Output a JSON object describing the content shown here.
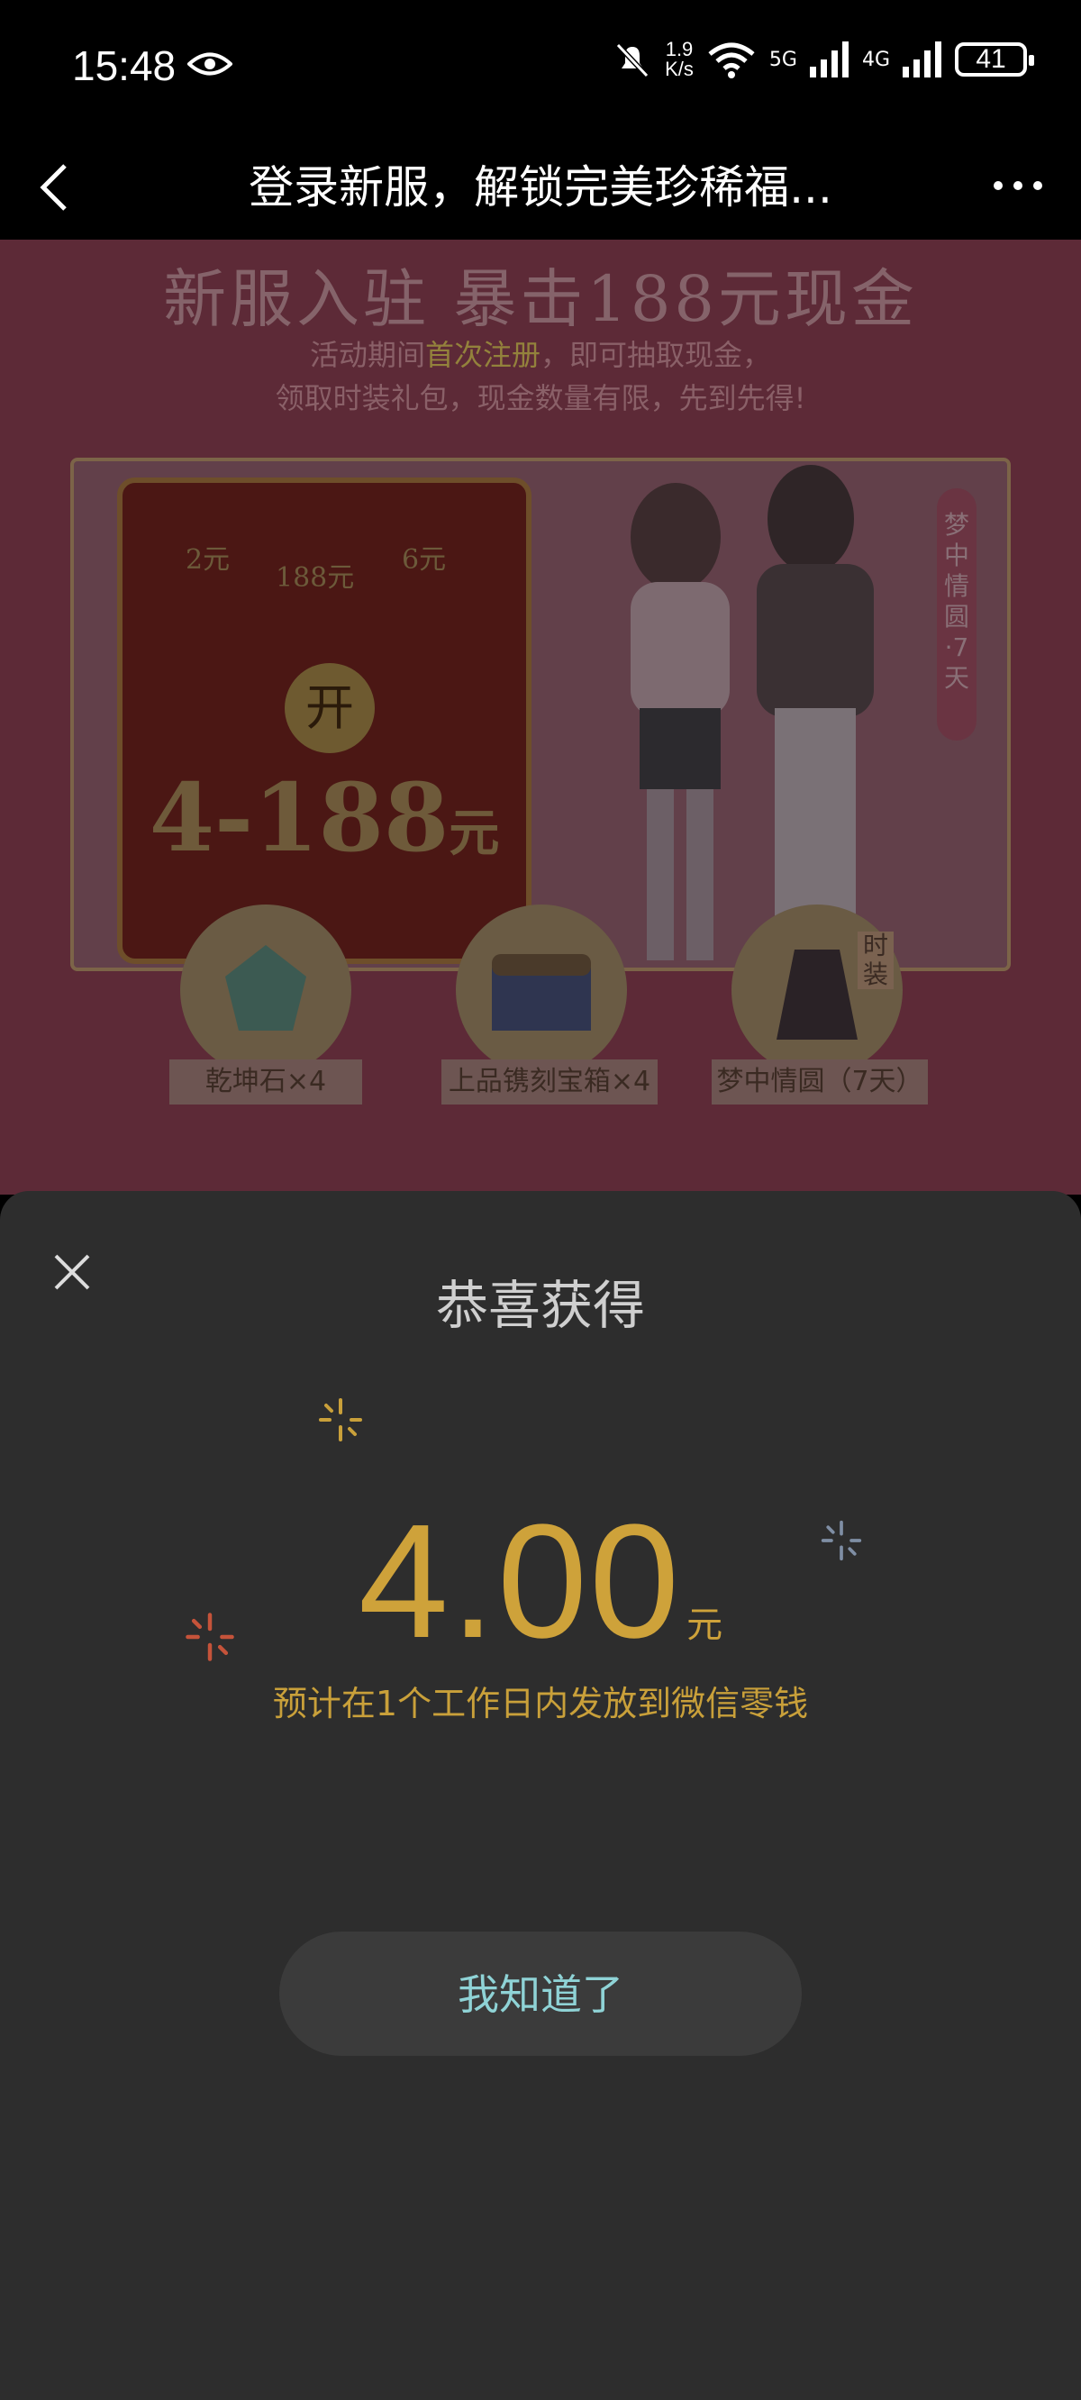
{
  "status_bar": {
    "time": "15:48",
    "network_speed_value": "1.9",
    "network_speed_unit": "K/s",
    "network_5g": "5G",
    "network_4g": "4G",
    "battery": "41"
  },
  "nav": {
    "title": "登录新服，解锁完美珍稀福..."
  },
  "promo": {
    "headline": "新服入驻 暴击188元现金",
    "subtitle_part1": "活动期间",
    "subtitle_highlight": "首次注册",
    "subtitle_part2": "，即可抽取现金，",
    "subtitle_line2": "领取时装礼包，现金数量有限，先到先得!",
    "envelope_open": "开",
    "envelope_amount": "4-188",
    "envelope_unit": "元",
    "envelope_coins": [
      "2元",
      "188元",
      "6元"
    ],
    "ribbon_text": "梦中情圆·7天",
    "rewards": [
      "乾坤石×4",
      "上品镌刻宝箱×4",
      "梦中情圆（7天）"
    ],
    "fashion_tag": "时装"
  },
  "sheet": {
    "title": "恭喜获得",
    "amount": "4.00",
    "unit": "元",
    "notice": "预计在1个工作日内发放到微信零钱",
    "button_label": "我知道了"
  },
  "colors": {
    "accent_gold": "#cea23a",
    "button_text": "#8fd3d6",
    "sheet_bg": "#2d2d2d"
  }
}
